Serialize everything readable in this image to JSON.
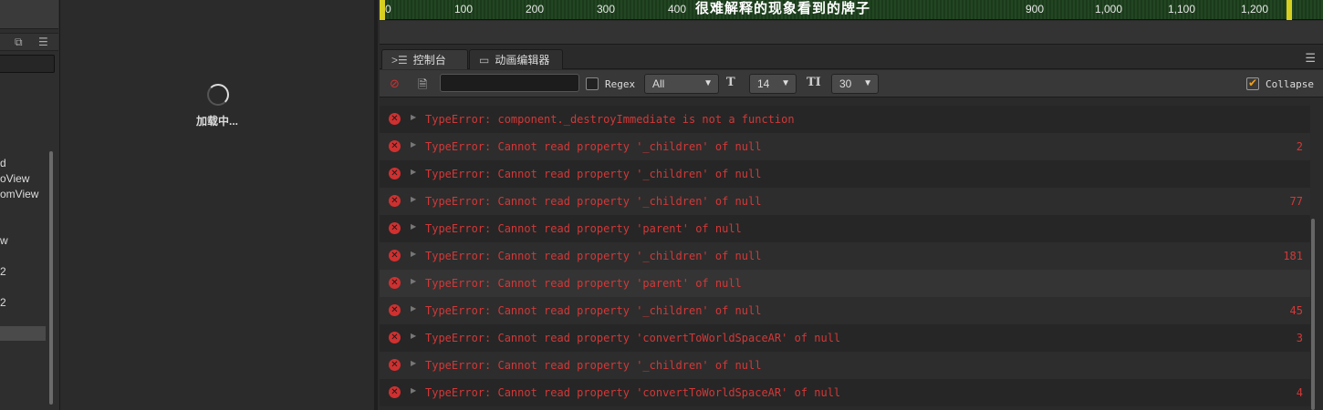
{
  "left": {
    "tree_items": [
      "d",
      "oView",
      "omView",
      "w",
      "2",
      "2"
    ]
  },
  "center": {
    "loading_text": "加载中..."
  },
  "timeline": {
    "ticks": [
      "0",
      "100",
      "200",
      "300",
      "400",
      "900",
      "1,000",
      "1,100",
      "1,200"
    ],
    "overlay_text": "很难解释的现象看到的牌子"
  },
  "tabs": [
    {
      "label": "控制台",
      "icon": "console-icon"
    },
    {
      "label": "动画编辑器",
      "icon": "animation-icon"
    }
  ],
  "toolbar": {
    "filter_value": "",
    "regex_label": "Regex",
    "regex_checked": false,
    "level_select": "All",
    "font_size_select": "14",
    "line_height_select": "30",
    "collapse_label": "Collapse",
    "collapse_checked": true
  },
  "logs": [
    {
      "msg": "TypeError: component._destroyImmediate is not a function",
      "count": ""
    },
    {
      "msg": "TypeError: Cannot read property '_children' of null",
      "count": "2"
    },
    {
      "msg": "TypeError: Cannot read property '_children' of null",
      "count": ""
    },
    {
      "msg": "TypeError: Cannot read property '_children' of null",
      "count": "77"
    },
    {
      "msg": "TypeError: Cannot read property 'parent' of null",
      "count": ""
    },
    {
      "msg": "TypeError: Cannot read property '_children' of null",
      "count": "181"
    },
    {
      "msg": "TypeError: Cannot read property 'parent' of null",
      "count": ""
    },
    {
      "msg": "TypeError: Cannot read property '_children' of null",
      "count": "45"
    },
    {
      "msg": "TypeError: Cannot read property 'convertToWorldSpaceAR' of null",
      "count": "3"
    },
    {
      "msg": "TypeError: Cannot read property '_children' of null",
      "count": ""
    },
    {
      "msg": "TypeError: Cannot read property 'convertToWorldSpaceAR' of null",
      "count": "4"
    }
  ],
  "colors": {
    "error": "#d23838",
    "timeline_marker": "#d8d020",
    "collapse_check": "#f0a020"
  }
}
